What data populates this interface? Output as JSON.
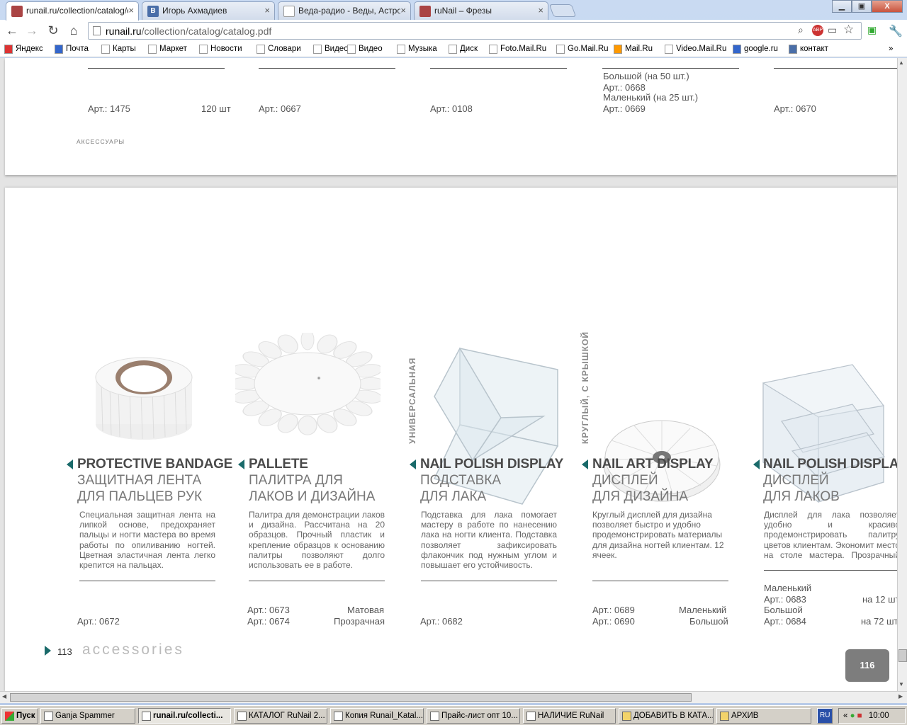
{
  "browser": {
    "tabs": [
      {
        "title": "runail.ru/collection/catalog/c",
        "close": "×",
        "fav": "",
        "color": "#a44"
      },
      {
        "title": "Игорь Ахмадиев",
        "close": "×",
        "fav": "B",
        "color": "#4a6ea8"
      },
      {
        "title": "Веда-радио - Веды, Астрол",
        "close": "×",
        "fav": "",
        "color": "#fff"
      },
      {
        "title": "ruNail – Фрезы",
        "close": "×",
        "fav": "",
        "color": "#a44"
      }
    ],
    "window_controls": {
      "min": "▁",
      "max": "▣",
      "close": "X"
    },
    "url_host": "runail.ru",
    "url_path": "/collection/catalog/catalog.pdf",
    "bookmarks": [
      {
        "label": "Яндекс",
        "icon": "yandex-icon",
        "color": "#d33"
      },
      {
        "label": "Почта",
        "icon": "mail-icon",
        "color": "#36c"
      },
      {
        "label": "Карты",
        "icon": "page-icon",
        "color": "#fff"
      },
      {
        "label": "Маркет",
        "icon": "page-icon",
        "color": "#fff"
      },
      {
        "label": "Новости",
        "icon": "page-icon",
        "color": "#fff"
      },
      {
        "label": "Словари",
        "icon": "page-icon",
        "color": "#fff"
      },
      {
        "label": "Видео",
        "icon": "page-icon",
        "color": "#fff"
      },
      {
        "label": "Видео",
        "icon": "page-icon",
        "color": "#fff"
      },
      {
        "label": "Музыка",
        "icon": "page-icon",
        "color": "#fff"
      },
      {
        "label": "Диск",
        "icon": "page-icon",
        "color": "#fff"
      },
      {
        "label": "Foto.Mail.Ru",
        "icon": "page-icon",
        "color": "#fff"
      },
      {
        "label": "Go.Mail.Ru",
        "icon": "page-icon",
        "color": "#fff"
      },
      {
        "label": "Mail.Ru",
        "icon": "mailru-icon",
        "color": "#f90"
      },
      {
        "label": "Video.Mail.Ru",
        "icon": "page-icon",
        "color": "#fff"
      },
      {
        "label": "google.ru",
        "icon": "google-icon",
        "color": "#36c"
      },
      {
        "label": "контакт",
        "icon": "vk-icon",
        "color": "#4a6ea8"
      }
    ],
    "bookmarks_more": "»"
  },
  "page_top": {
    "items": [
      {
        "art": "Арт.: 1475",
        "qty": "120 шт"
      },
      {
        "art": "Арт.: 0667"
      },
      {
        "art": "Арт.: 0108"
      },
      {
        "line1": "Большой (на 50 шт.)",
        "line2": "Арт.: 0668",
        "line3": "Маленький (на 25 шт.)",
        "art": "Арт.: 0669"
      },
      {
        "art": "Арт.: 0670"
      }
    ],
    "section": "АКСЕССУАРЫ"
  },
  "page_main": {
    "products": [
      {
        "en": "PROTECTIVE BANDAGE",
        "ru1": "ЗАЩИТНАЯ ЛЕНТА",
        "ru2": "ДЛЯ ПАЛЬЦЕВ РУК",
        "desc": "Специальная защитная лента на липкой основе, предохраняет пальцы и ногти мастера во время работы по опиливанию ногтей. Цветная эластичная лента легко крепится на пальцах.",
        "arts": [
          {
            "a": "Арт.: 0672",
            "n": ""
          }
        ]
      },
      {
        "en": "PALLETE",
        "ru1": "ПАЛИТРА ДЛЯ",
        "ru2": "ЛАКОВ И ДИЗАЙНА",
        "desc": "Палитра для демонстрации лаков и дизайна. Рассчитана на 20 образцов. Прочный пластик и крепление образцов к основанию палитры позволяют долго использовать ее в работе.",
        "arts": [
          {
            "a": "Арт.: 0673",
            "n": "Матовая"
          },
          {
            "a": "Арт.: 0674",
            "n": "Прозрачная"
          }
        ]
      },
      {
        "en": "NAIL POLISH DISPLAY",
        "ru1": "ПОДСТАВКА",
        "ru2": "ДЛЯ ЛАКА",
        "vertical": "УНИВЕРСАЛЬНАЯ",
        "desc": "Подставка для лака помогает мастеру в работе по нанесению лака на ногти клиента. Подставка позволяет зафиксировать флакончик под нужным углом и повышает его устойчивость.",
        "arts": [
          {
            "a": "Арт.: 0682",
            "n": ""
          }
        ]
      },
      {
        "en": "NAIL ART DISPLAY",
        "ru1": "ДИСПЛЕЙ",
        "ru2": "ДЛЯ ДИЗАЙНА",
        "vertical": "КРУГЛЫЙ, С КРЫШКОЙ",
        "desc": "Круглый дисплей для дизайна позволяет быстро и удобно продемонстрировать материалы для дизайна ногтей клиентам. 12 ячеек.",
        "arts": [
          {
            "a": "Арт.: 0689",
            "n": "Маленький"
          },
          {
            "a": "Арт.: 0690",
            "n": "Большой"
          }
        ]
      },
      {
        "en": "NAIL POLISH DISPLAY",
        "ru1": "ДИСПЛЕЙ",
        "ru2": "ДЛЯ ЛАКОВ",
        "desc": "Дисплей для лака позволяет удобно и красиво продемонстрировать палитру цветов клиентам. Экономит место на столе мастера. Прозрачный пластик подходит к любому интерьеру салона.",
        "sizes": [
          {
            "l": "Маленький",
            "a": "Арт.: 0683",
            "n": "на 12 шт"
          },
          {
            "l": "Большой",
            "a": "Арт.: 0684",
            "n": "на 72 шт"
          }
        ]
      }
    ],
    "page_number": "113",
    "footer_word": "accessories",
    "badge": "116"
  },
  "taskbar": {
    "start": "Пуск",
    "items": [
      "Ganja Spammer",
      "runail.ru/collecti...",
      "КАТАЛОГ RuNail 2...",
      "Копия Runail_Katal...",
      "Прайс-лист опт 10...",
      "НАЛИЧИЕ RuNail",
      "ДОБАВИТЬ В КАТА...",
      "АРХИВ"
    ],
    "lang": "RU",
    "clock": "10:00"
  }
}
